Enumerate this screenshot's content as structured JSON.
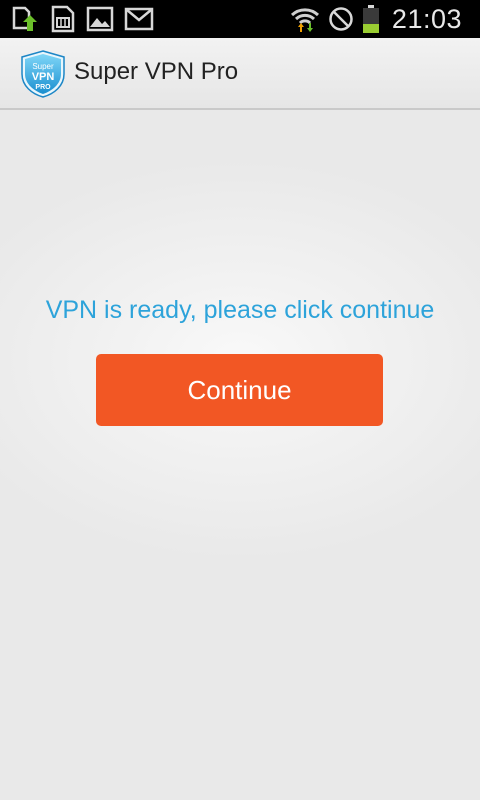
{
  "status_bar": {
    "time": "21:03",
    "left_icons": [
      "usb-upload-icon",
      "sd-card-icon",
      "image-icon",
      "mail-icon"
    ],
    "right_icons": [
      "wifi-icon",
      "no-sim-icon",
      "battery-icon"
    ],
    "battery_level": 0.35,
    "battery_color": "#9acd32"
  },
  "action_bar": {
    "title": "Super VPN Pro",
    "icon": "super-vpn-shield-logo",
    "logo_text": [
      "Super",
      "VPN",
      "PRO"
    ]
  },
  "main": {
    "message": "VPN is ready, please click continue",
    "continue_label": "Continue"
  },
  "colors": {
    "accent_text": "#2da3da",
    "button": "#f25724",
    "button_text": "#ffffff"
  }
}
